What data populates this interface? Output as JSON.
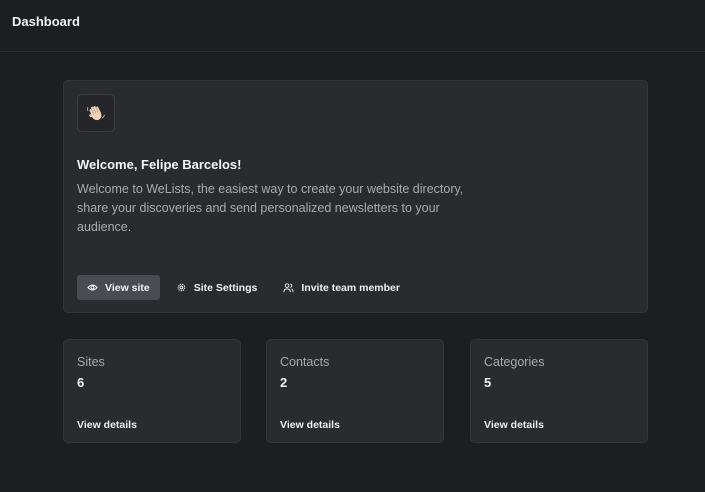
{
  "header": {
    "title": "Dashboard"
  },
  "welcome": {
    "emoji_icon": "waving-hand-icon",
    "title": "Welcome, Felipe Barcelos!",
    "description": "Welcome to WeLists, the easiest way to create your website directory, share your discoveries and send personalized newsletters to your audience.",
    "actions": [
      {
        "label": "View site",
        "icon": "eye-icon"
      },
      {
        "label": "Site Settings",
        "icon": "gear-icon"
      },
      {
        "label": "Invite team member",
        "icon": "users-icon"
      }
    ]
  },
  "stats": [
    {
      "label": "Sites",
      "value": "6",
      "link": "View details"
    },
    {
      "label": "Contacts",
      "value": "2",
      "link": "View details"
    },
    {
      "label": "Categories",
      "value": "5",
      "link": "View details"
    }
  ],
  "colors": {
    "background": "#1d1e21",
    "card": "#2a2b2f",
    "primary_button": "#4a4b51"
  }
}
